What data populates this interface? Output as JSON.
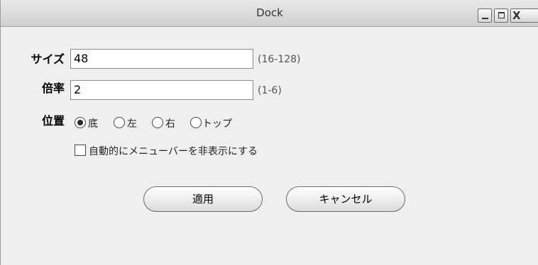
{
  "window": {
    "title": "Dock",
    "controls": {
      "minimize": "_",
      "maximize": "□",
      "close": "X"
    }
  },
  "form": {
    "size": {
      "label": "サイズ",
      "value": "48",
      "hint": "(16-128)"
    },
    "magnification": {
      "label": "倍率",
      "value": "2",
      "hint": "(1-6)"
    },
    "position": {
      "label": "位置",
      "options": [
        "底",
        "左",
        "右",
        "トップ"
      ],
      "selected": "底"
    },
    "autohide": {
      "label": "自動的にメニューバーを非表示にする",
      "checked": false
    }
  },
  "buttons": {
    "apply": "適用",
    "cancel": "キャンセル"
  }
}
